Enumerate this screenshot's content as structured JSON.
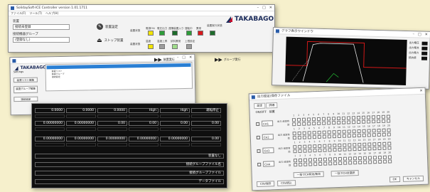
{
  "colors": {
    "background": "#f6f0cc",
    "brand_navy": "#1a2a5a",
    "brand_red": "#c8102e",
    "selection_blue": "#2a7fd4",
    "plot_red": "#d01818",
    "plot_white": "#e8e8e8",
    "plot_green": "#22b030",
    "indicator_yellow": "#f2e400",
    "indicator_green": "#2e9d3a",
    "indicator_lightgreen": "#9fdc8a",
    "indicator_darkgreen": "#1d6b2b",
    "indicator_gray": "#9c9c9c",
    "indicator_red": "#d8191c"
  },
  "main_window": {
    "title": "SolidaySoft-ICE Controller   version 1.01.1711",
    "menu": [
      "ファイル(F)",
      "ツール(T)",
      "ヘルプ(H)"
    ],
    "device_label": "装置",
    "device_value": "接続未登録",
    "group_label": "接続機器グループ",
    "group_value": "(登録なし)",
    "logo_text": "TAKABAGO",
    "btn_settings": "装置設定",
    "btn_stop": "ストップ装置",
    "btn_run": "装置実行",
    "btn_group_run": "グループ実行",
    "indicator_group_top": "装置状態",
    "indicator_group_bottom": "装置状態",
    "indicator_labels_top": [
      "電源ON",
      "電圧出力",
      "遠隔装置入り",
      "運転中",
      "異常",
      "装置実行状態"
    ],
    "indicator_labels_bottom": [
      "温度",
      "温度上昇",
      "試料異常",
      "上限設定",
      ""
    ]
  },
  "list_window": {
    "title": "",
    "logo_text": "TAKABAGO",
    "side_title": "Settings",
    "side_buttons": [
      "装置リスト編集",
      "装置グループ編集",
      "接続設定"
    ],
    "tree_items": [
      "装置リスト",
      "装置グループ",
      "接続設定"
    ]
  },
  "dark_window": {
    "row1": [
      "0.0000",
      "0.0000",
      "0.0000",
      "High",
      "High",
      "運転停止"
    ],
    "row2": [
      "0.00000000",
      "0.00000000",
      "0.00",
      "0.00",
      "0.00",
      "0.00"
    ],
    "row3": [
      "0.00000000",
      "0.00000000",
      "0.00000000",
      "0.00000000",
      "0.00000000",
      "0.00"
    ],
    "bars": [
      "装置なし",
      "接続グループファイル名",
      "接続グループファイル",
      "データファイル"
    ]
  },
  "graph_window": {
    "title": "グラフ表示ウインドウ",
    "legend": [
      "出力電圧",
      "出力電流",
      "出力電力",
      "抵抗値"
    ]
  },
  "grid_window": {
    "title": "出力設定/保存ファイル",
    "tabs": [
      "設定",
      "詳細"
    ],
    "col_header": [
      "ON/OFF",
      "装置"
    ],
    "rows": [
      {
        "select": "CH1",
        "name": "出力 設定有効"
      },
      {
        "select": "CH2",
        "name": "出力 設定有効"
      },
      {
        "select": "CH3",
        "name": "出力 設定有効"
      },
      {
        "select": "CH4",
        "name": "出力 設定有効"
      }
    ],
    "numbers": [
      "1",
      "2",
      "3",
      "4",
      "5",
      "6",
      "7",
      "8",
      "9",
      "10",
      "11",
      "12",
      "13",
      "14",
      "15",
      "16",
      "17",
      "18",
      "19",
      "20"
    ],
    "mid_buttons": [
      "一括でCH有効/無効",
      "一括でCH全選択"
    ],
    "bottom_left": [
      "CSV保存",
      "CSV読込"
    ],
    "bottom_right": [
      "OK",
      "キャンセル"
    ]
  }
}
